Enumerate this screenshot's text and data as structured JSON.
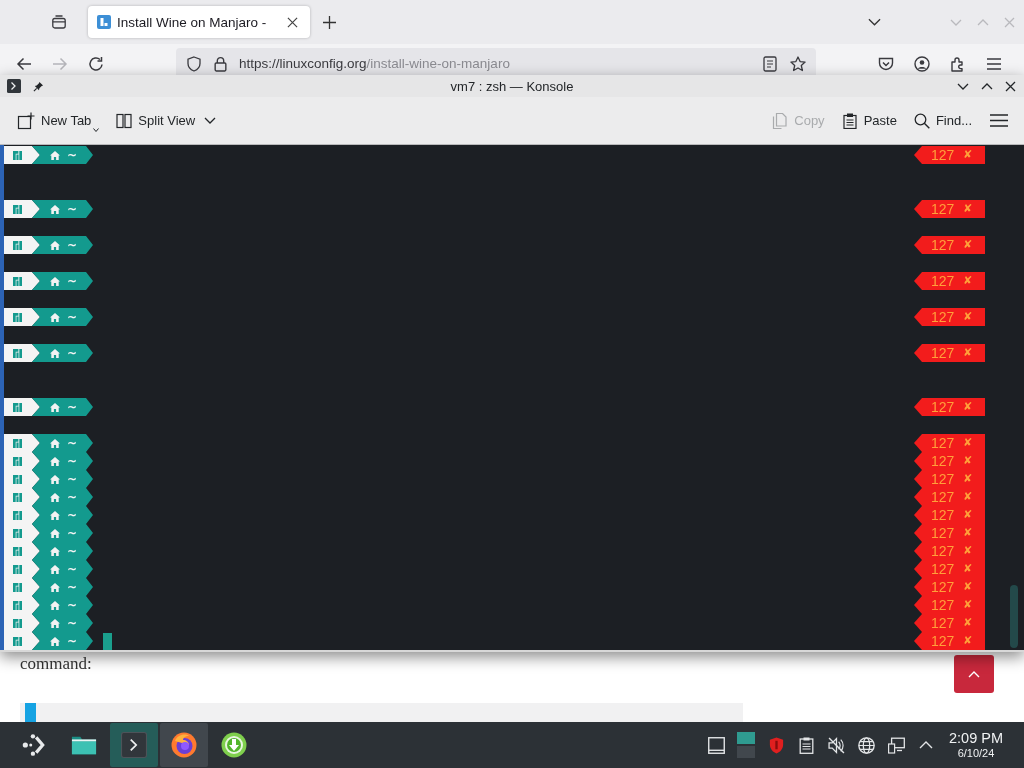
{
  "browser": {
    "tabs": [
      {
        "title": "Install Wine on Manjaro -",
        "selected": true
      }
    ],
    "nav_buttons": [
      {
        "kind": "back",
        "disabled": false
      },
      {
        "kind": "forward",
        "disabled": true
      },
      {
        "kind": "reload",
        "disabled": false
      }
    ],
    "url": {
      "host": "https://linuxconfig.org",
      "path": "/install-wine-on-manjaro"
    }
  },
  "konsole": {
    "title": "vm7 : zsh — Konsole",
    "toolbar_left": [
      {
        "kind": "new-tab",
        "label": "New Tab",
        "disabled": false
      },
      {
        "kind": "split-view",
        "label": "Split View",
        "disabled": false
      }
    ],
    "toolbar_right": [
      {
        "kind": "copy",
        "label": "Copy",
        "disabled": true
      },
      {
        "kind": "paste",
        "label": "Paste",
        "disabled": false
      },
      {
        "kind": "find",
        "label": "Find...",
        "disabled": false
      }
    ],
    "lines": [
      {
        "kind": "prompt",
        "path": "~",
        "code": "127",
        "mark": "✘",
        "cursor": false
      },
      {
        "kind": "blank",
        "cursor": false
      },
      {
        "kind": "blank",
        "cursor": false
      },
      {
        "kind": "prompt",
        "path": "~",
        "code": "127",
        "mark": "✘",
        "cursor": false
      },
      {
        "kind": "blank",
        "cursor": false
      },
      {
        "kind": "prompt",
        "path": "~",
        "code": "127",
        "mark": "✘",
        "cursor": false
      },
      {
        "kind": "blank",
        "cursor": false
      },
      {
        "kind": "prompt",
        "path": "~",
        "code": "127",
        "mark": "✘",
        "cursor": false
      },
      {
        "kind": "blank",
        "cursor": false
      },
      {
        "kind": "prompt",
        "path": "~",
        "code": "127",
        "mark": "✘",
        "cursor": false
      },
      {
        "kind": "blank",
        "cursor": false
      },
      {
        "kind": "prompt",
        "path": "~",
        "code": "127",
        "mark": "✘",
        "cursor": false
      },
      {
        "kind": "blank",
        "cursor": false
      },
      {
        "kind": "blank",
        "cursor": false
      },
      {
        "kind": "prompt",
        "path": "~",
        "code": "127",
        "mark": "✘",
        "cursor": false
      },
      {
        "kind": "blank",
        "cursor": false
      },
      {
        "kind": "prompt",
        "path": "~",
        "code": "127",
        "mark": "✘",
        "cursor": false
      },
      {
        "kind": "prompt",
        "path": "~",
        "code": "127",
        "mark": "✘",
        "cursor": false
      },
      {
        "kind": "prompt",
        "path": "~",
        "code": "127",
        "mark": "✘",
        "cursor": false
      },
      {
        "kind": "prompt",
        "path": "~",
        "code": "127",
        "mark": "✘",
        "cursor": false
      },
      {
        "kind": "prompt",
        "path": "~",
        "code": "127",
        "mark": "✘",
        "cursor": false
      },
      {
        "kind": "prompt",
        "path": "~",
        "code": "127",
        "mark": "✘",
        "cursor": false
      },
      {
        "kind": "prompt",
        "path": "~",
        "code": "127",
        "mark": "✘",
        "cursor": false
      },
      {
        "kind": "prompt",
        "path": "~",
        "code": "127",
        "mark": "✘",
        "cursor": false
      },
      {
        "kind": "prompt",
        "path": "~",
        "code": "127",
        "mark": "✘",
        "cursor": false
      },
      {
        "kind": "prompt",
        "path": "~",
        "code": "127",
        "mark": "✘",
        "cursor": false
      },
      {
        "kind": "prompt",
        "path": "~",
        "code": "127",
        "mark": "✘",
        "cursor": false
      },
      {
        "kind": "prompt",
        "path": "~",
        "code": "127",
        "mark": "✘",
        "cursor": true
      }
    ]
  },
  "page": {
    "text": "command:"
  },
  "taskbar": {
    "tasks": [
      {
        "kind": "files",
        "selected": false,
        "open": false
      },
      {
        "kind": "terminal",
        "selected": true,
        "open": true
      },
      {
        "kind": "browser",
        "selected": false,
        "open": true
      },
      {
        "kind": "downloader",
        "selected": false,
        "open": false
      }
    ],
    "pager": [
      {
        "selected": true
      },
      {
        "selected": false
      }
    ],
    "clock": {
      "time": "2:09 PM",
      "date": "6/10/24"
    }
  }
}
